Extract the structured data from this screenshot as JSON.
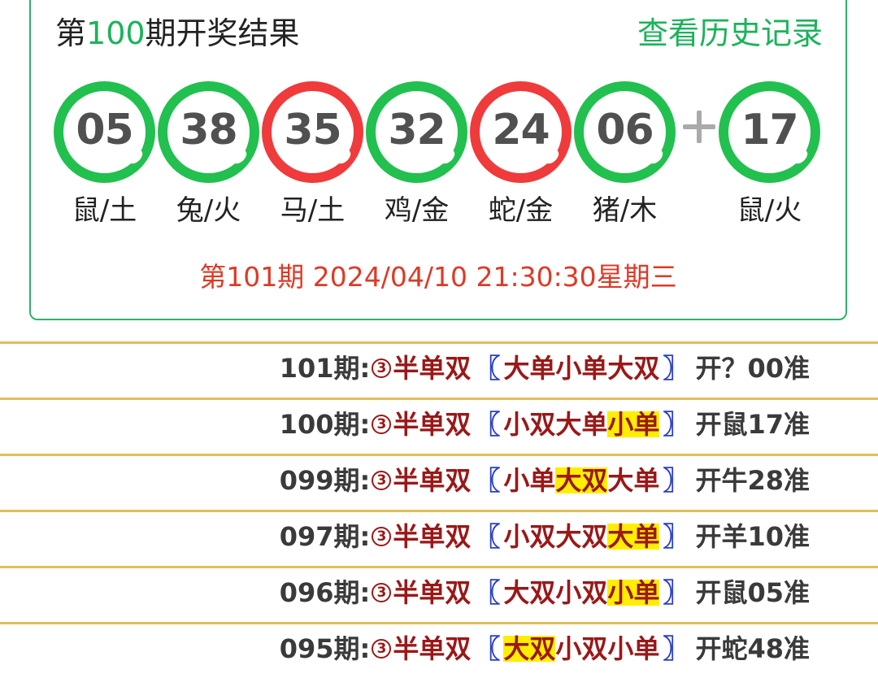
{
  "header": {
    "title_prefix": "第",
    "title_num": "100",
    "title_suffix": "期开奖结果",
    "history_link": "查看历史记录"
  },
  "balls": [
    {
      "num": "05",
      "zodiac": "鼠/土",
      "color": "green"
    },
    {
      "num": "38",
      "zodiac": "兔/火",
      "color": "green"
    },
    {
      "num": "35",
      "zodiac": "马/土",
      "color": "red"
    },
    {
      "num": "32",
      "zodiac": "鸡/金",
      "color": "green"
    },
    {
      "num": "24",
      "zodiac": "蛇/金",
      "color": "red"
    },
    {
      "num": "06",
      "zodiac": "猪/木",
      "color": "green"
    }
  ],
  "special_ball": {
    "num": "17",
    "zodiac": "鼠/火",
    "color": "green"
  },
  "colors": {
    "green": "#22c04f",
    "red": "#ef3b3b",
    "accent_green": "#1bb35a",
    "date_red": "#dd3a27",
    "divider_gold": "#e2bd5a",
    "highlight": "#ffee00"
  },
  "next_draw": "第101期 2024/04/10 21:30:30星期三",
  "predictions": [
    {
      "period": "101期:",
      "circle": "3",
      "type": "半单双",
      "picks": [
        {
          "text": "大单",
          "hit": false
        },
        {
          "text": "小单",
          "hit": false
        },
        {
          "text": "大双",
          "hit": false
        }
      ],
      "result": "开？00准"
    },
    {
      "period": "100期:",
      "circle": "3",
      "type": "半单双",
      "picks": [
        {
          "text": "小双",
          "hit": false
        },
        {
          "text": "大单",
          "hit": false
        },
        {
          "text": "小单",
          "hit": true
        }
      ],
      "result": "开鼠17准"
    },
    {
      "period": "099期:",
      "circle": "3",
      "type": "半单双",
      "picks": [
        {
          "text": "小单",
          "hit": false
        },
        {
          "text": "大双",
          "hit": true
        },
        {
          "text": "大单",
          "hit": false
        }
      ],
      "result": "开牛28准"
    },
    {
      "period": "097期:",
      "circle": "3",
      "type": "半单双",
      "picks": [
        {
          "text": "小双",
          "hit": false
        },
        {
          "text": "大双",
          "hit": false
        },
        {
          "text": "大单",
          "hit": true
        }
      ],
      "result": "开羊10准"
    },
    {
      "period": "096期:",
      "circle": "3",
      "type": "半单双",
      "picks": [
        {
          "text": "大双",
          "hit": false
        },
        {
          "text": "小双",
          "hit": false
        },
        {
          "text": "小单",
          "hit": true
        }
      ],
      "result": "开鼠05准"
    },
    {
      "period": "095期:",
      "circle": "3",
      "type": "半单双",
      "picks": [
        {
          "text": "大双",
          "hit": true
        },
        {
          "text": "小双",
          "hit": false
        },
        {
          "text": "小单",
          "hit": false
        }
      ],
      "result": "开蛇48准"
    }
  ]
}
